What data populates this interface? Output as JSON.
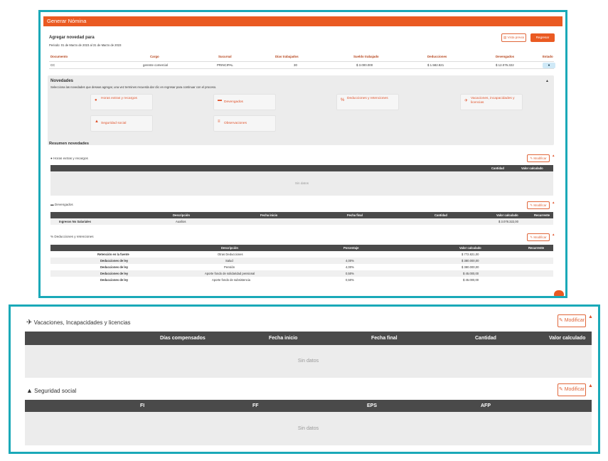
{
  "title_bar": "Generar Nómina",
  "header": {
    "title": "Agregar novedad para",
    "period": "Periodo: 01 de Marzo de 2023 al 31 de Marzo de 2023",
    "preview_button": "Vista previa",
    "back_button": "Regresar"
  },
  "employee_table": {
    "headers": [
      "Documento",
      "Cargo",
      "Sucursal",
      "Días trabajados",
      "Sueldo trabajado",
      "Deducciones",
      "Devengados",
      "Estado"
    ],
    "row": [
      "CC",
      "gerente comercial",
      "PRINCIPAL",
      "30",
      "$ 3.000.000",
      "$ 1.582.821",
      "$ 12.076.322"
    ]
  },
  "novedades": {
    "title": "Novedades",
    "description": "Selecciona las novedades que deseas agregar, una vez termines recuerda dar clic en regresar para continuar con el proceso.",
    "tiles": [
      {
        "label": "Horas extras y recargos",
        "icon": "clock-icon"
      },
      {
        "label": "Devengados",
        "icon": "money-icon"
      },
      {
        "label": "Deducciones y retenciones",
        "icon": "percent-icon"
      },
      {
        "label": "Vacaciones, incapacidades y licencias",
        "icon": "plane-icon"
      },
      {
        "label": "Seguridad social",
        "icon": "helmet-icon"
      },
      {
        "label": "Observaciones",
        "icon": "notes-icon"
      }
    ]
  },
  "resumen": {
    "title": "Resumen novedades",
    "modify_label": "Modificar",
    "no_data": "Sin datos",
    "horas": {
      "title": "Horas extras y recargos",
      "headers": [
        "Cantidad",
        "Valor calculado"
      ]
    },
    "devengados": {
      "title": "Devengados",
      "headers": [
        "Descripción",
        "Fecha inicio",
        "Fecha final",
        "Cantidad",
        "Valor calculado",
        "Recurrente"
      ],
      "rows": [
        [
          "Ingresos No Salariales",
          "Auxilios",
          "",
          "",
          "",
          "$ 3.078.322,00",
          ""
        ]
      ]
    },
    "deducciones": {
      "title": "Deducciones y retenciones",
      "headers": [
        "Descripción",
        "Porcentaje",
        "Valor calculado",
        "Recurrente"
      ],
      "rows": [
        [
          "Retención en la fuente",
          "Otras Deducciones",
          "",
          "$ 772.821,00"
        ],
        [
          "Deducciones de ley",
          "Salud",
          "4,00%",
          "$ 380.000,00"
        ],
        [
          "Deducciones de ley",
          "Pensión",
          "4,00%",
          "$ 380.000,00"
        ],
        [
          "Deducciones de ley",
          "Aporte fondo de solidaridad pensional",
          "0,50%",
          "$ 45.000,00"
        ],
        [
          "Deducciones de ley",
          "Aporte fondo de subsistencia",
          "0,50%",
          "$ 45.000,00"
        ]
      ]
    },
    "vacaciones": {
      "title": "Vacaciones, Incapacidades y licencias",
      "headers": [
        "Días compensados",
        "Fecha inicio",
        "Fecha final",
        "Cantidad",
        "Valor calculado"
      ]
    },
    "seguridad": {
      "title": "Seguridad social",
      "headers": [
        "FI",
        "FF",
        "EPS",
        "AFP"
      ]
    }
  },
  "colors": {
    "accent": "#ea5a22",
    "frame": "#1aa9b8",
    "table_header": "#4a4a4a"
  }
}
